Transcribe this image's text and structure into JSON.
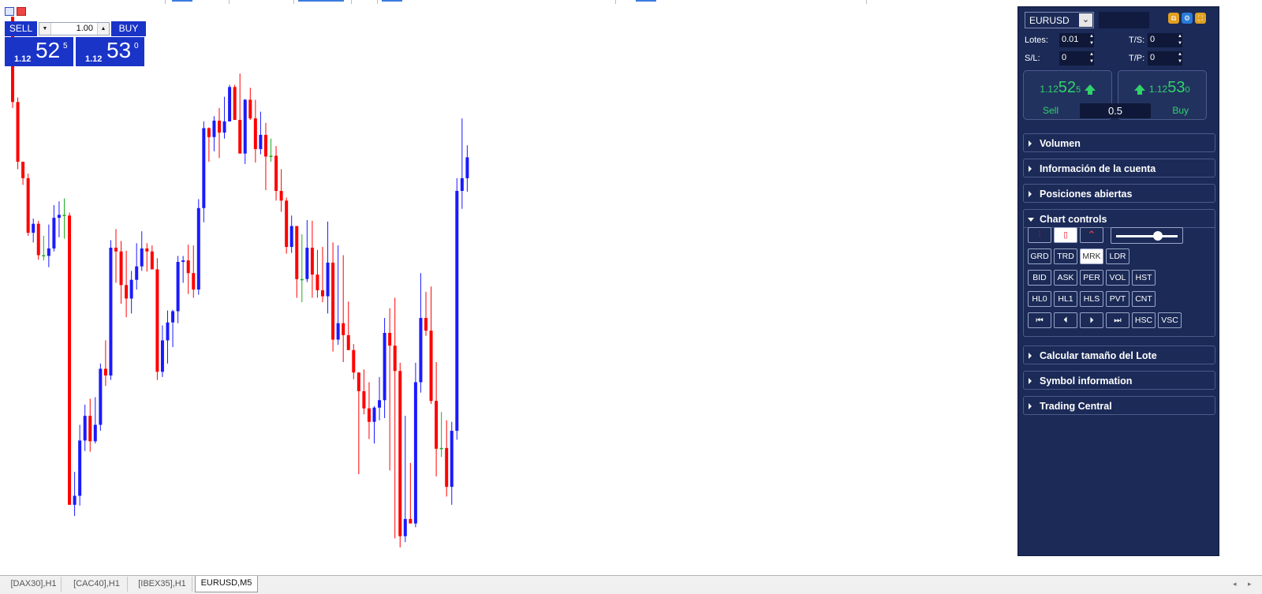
{
  "one_click": {
    "sell_label": "SELL",
    "buy_label": "BUY",
    "lot_value": "1.00",
    "sell_price": {
      "prefix": "1.12",
      "big": "52",
      "sup": "5"
    },
    "buy_price": {
      "prefix": "1.12",
      "big": "53",
      "sup": "0"
    }
  },
  "panel": {
    "symbol": "EURUSD",
    "lotes_label": "Lotes:",
    "lotes_value": "0.01",
    "ts_label": "T/S:",
    "ts_value": "0",
    "sl_label": "S/L:",
    "sl_value": "0",
    "tp_label": "T/P:",
    "tp_value": "0",
    "sell_price": {
      "prefix": "1.12",
      "big": "52",
      "sup": "5"
    },
    "buy_price": {
      "prefix": "1.12",
      "big": "53",
      "sup": "0"
    },
    "sell_label": "Sell",
    "buy_label": "Buy",
    "lot_center": "0.5",
    "sections": {
      "volumen": "Volumen",
      "cuenta": "Información de la cuenta",
      "posiciones": "Posiciones abiertas",
      "chart_controls": "Chart controls",
      "lote": "Calcular tamaño del Lote",
      "symbol_info": "Symbol information",
      "trading_central": "Trading Central"
    },
    "control_rows": [
      [
        "GRD",
        "TRD",
        "MRK",
        "LDR"
      ],
      [
        "BID",
        "ASK",
        "PER",
        "VOL",
        "HST"
      ],
      [
        "HL0",
        "HL1",
        "HLS",
        "PVT",
        "CNT"
      ],
      [
        "⏮",
        "⏴",
        "⏵",
        "⏭",
        "HSC",
        "VSC"
      ]
    ],
    "active_control": "MRK",
    "slider_level": 0.68,
    "colors": {
      "panel": "#1b2a57",
      "price_green": "#2fd36a",
      "btn_blue": "#1a34c8"
    }
  },
  "tabs": [
    "[DAX30],H1",
    "[CAC40],H1",
    "[IBEX35],H1",
    "EURUSD,M5"
  ],
  "active_tab": "EURUSD,M5",
  "chart_data": {
    "type": "candlestick",
    "symbol": "EURUSD",
    "timeframe": "M5",
    "ylim": [
      1.1186,
      1.1262
    ],
    "bull_color": "#1a1aff",
    "bear_color": "#ff0000",
    "doji_color": "#22aa22",
    "candles": [
      {
        "o": 1.12606,
        "h": 1.12606,
        "l": 1.12484,
        "c": 1.12492
      },
      {
        "o": 1.12492,
        "h": 1.12498,
        "l": 1.12402,
        "c": 1.12412
      },
      {
        "o": 1.12412,
        "h": 1.12412,
        "l": 1.12381,
        "c": 1.1239
      },
      {
        "o": 1.1239,
        "h": 1.12396,
        "l": 1.12313,
        "c": 1.12317
      },
      {
        "o": 1.12317,
        "h": 1.12336,
        "l": 1.12304,
        "c": 1.12329
      },
      {
        "o": 1.12329,
        "h": 1.12333,
        "l": 1.12281,
        "c": 1.12287
      },
      {
        "o": 1.12287,
        "h": 1.12313,
        "l": 1.1228,
        "c": 1.12286
      },
      {
        "o": 1.12286,
        "h": 1.12328,
        "l": 1.12271,
        "c": 1.12296
      },
      {
        "o": 1.12296,
        "h": 1.12354,
        "l": 1.12292,
        "c": 1.12337
      },
      {
        "o": 1.12337,
        "h": 1.12359,
        "l": 1.12311,
        "c": 1.12341
      },
      {
        "o": 1.12341,
        "h": 1.12363,
        "l": 1.12309,
        "c": 1.1234
      },
      {
        "o": 1.1234,
        "h": 1.12344,
        "l": 1.1199,
        "c": 1.11953
      },
      {
        "o": 1.11953,
        "h": 1.11997,
        "l": 1.11938,
        "c": 1.11965
      },
      {
        "o": 1.11965,
        "h": 1.1206,
        "l": 1.11952,
        "c": 1.12039
      },
      {
        "o": 1.12039,
        "h": 1.12087,
        "l": 1.12025,
        "c": 1.12072
      },
      {
        "o": 1.12072,
        "h": 1.12095,
        "l": 1.12024,
        "c": 1.12038
      },
      {
        "o": 1.12038,
        "h": 1.12097,
        "l": 1.12035,
        "c": 1.1206
      },
      {
        "o": 1.1206,
        "h": 1.12142,
        "l": 1.12052,
        "c": 1.12135
      },
      {
        "o": 1.12135,
        "h": 1.12173,
        "l": 1.12112,
        "c": 1.12126
      },
      {
        "o": 1.12126,
        "h": 1.12307,
        "l": 1.1212,
        "c": 1.12297
      },
      {
        "o": 1.12297,
        "h": 1.12322,
        "l": 1.1225,
        "c": 1.12292
      },
      {
        "o": 1.12292,
        "h": 1.12306,
        "l": 1.12222,
        "c": 1.12247
      },
      {
        "o": 1.12247,
        "h": 1.12293,
        "l": 1.12204,
        "c": 1.12229
      },
      {
        "o": 1.12229,
        "h": 1.12266,
        "l": 1.12209,
        "c": 1.12254
      },
      {
        "o": 1.12254,
        "h": 1.12303,
        "l": 1.12241,
        "c": 1.12272
      },
      {
        "o": 1.12272,
        "h": 1.12319,
        "l": 1.12266,
        "c": 1.12296
      },
      {
        "o": 1.12296,
        "h": 1.12303,
        "l": 1.12265,
        "c": 1.12292
      },
      {
        "o": 1.12292,
        "h": 1.123,
        "l": 1.12269,
        "c": 1.12268
      },
      {
        "o": 1.12268,
        "h": 1.12283,
        "l": 1.1212,
        "c": 1.12131
      },
      {
        "o": 1.12131,
        "h": 1.12193,
        "l": 1.12124,
        "c": 1.12173
      },
      {
        "o": 1.12173,
        "h": 1.12213,
        "l": 1.12142,
        "c": 1.12197
      },
      {
        "o": 1.12197,
        "h": 1.12214,
        "l": 1.12164,
        "c": 1.12212
      },
      {
        "o": 1.12212,
        "h": 1.12286,
        "l": 1.12196,
        "c": 1.12278
      },
      {
        "o": 1.12278,
        "h": 1.12286,
        "l": 1.1225,
        "c": 1.1228
      },
      {
        "o": 1.1228,
        "h": 1.12301,
        "l": 1.12235,
        "c": 1.12263
      },
      {
        "o": 1.12263,
        "h": 1.123,
        "l": 1.1223,
        "c": 1.12241
      },
      {
        "o": 1.12241,
        "h": 1.12362,
        "l": 1.12234,
        "c": 1.1235
      },
      {
        "o": 1.1235,
        "h": 1.12466,
        "l": 1.12331,
        "c": 1.12457
      },
      {
        "o": 1.12457,
        "h": 1.12458,
        "l": 1.12412,
        "c": 1.12445
      },
      {
        "o": 1.12445,
        "h": 1.12473,
        "l": 1.12426,
        "c": 1.12467
      },
      {
        "o": 1.12467,
        "h": 1.12484,
        "l": 1.12417,
        "c": 1.12451
      },
      {
        "o": 1.12451,
        "h": 1.12499,
        "l": 1.12443,
        "c": 1.12466
      },
      {
        "o": 1.12466,
        "h": 1.12515,
        "l": 1.12466,
        "c": 1.12512
      },
      {
        "o": 1.12512,
        "h": 1.12515,
        "l": 1.12482,
        "c": 1.12468
      },
      {
        "o": 1.12468,
        "h": 1.1253,
        "l": 1.12427,
        "c": 1.12423
      },
      {
        "o": 1.12423,
        "h": 1.12496,
        "l": 1.12409,
        "c": 1.12495
      },
      {
        "o": 1.12495,
        "h": 1.12511,
        "l": 1.12468,
        "c": 1.1247
      },
      {
        "o": 1.1247,
        "h": 1.12495,
        "l": 1.12411,
        "c": 1.12429
      },
      {
        "o": 1.12429,
        "h": 1.12479,
        "l": 1.12422,
        "c": 1.12448
      },
      {
        "o": 1.12448,
        "h": 1.12464,
        "l": 1.12374,
        "c": 1.12419
      },
      {
        "o": 1.12419,
        "h": 1.12443,
        "l": 1.12412,
        "c": 1.1242
      },
      {
        "o": 1.1242,
        "h": 1.12433,
        "l": 1.1236,
        "c": 1.12373
      },
      {
        "o": 1.12373,
        "h": 1.12402,
        "l": 1.12345,
        "c": 1.1236
      },
      {
        "o": 1.1236,
        "h": 1.12364,
        "l": 1.12289,
        "c": 1.12298
      },
      {
        "o": 1.12298,
        "h": 1.1234,
        "l": 1.1229,
        "c": 1.12326
      },
      {
        "o": 1.12326,
        "h": 1.1232,
        "l": 1.1223,
        "c": 1.12255
      },
      {
        "o": 1.12255,
        "h": 1.12315,
        "l": 1.12224,
        "c": 1.12255
      },
      {
        "o": 1.12255,
        "h": 1.12334,
        "l": 1.12251,
        "c": 1.12297
      },
      {
        "o": 1.12297,
        "h": 1.12333,
        "l": 1.1223,
        "c": 1.12261
      },
      {
        "o": 1.12261,
        "h": 1.12294,
        "l": 1.1223,
        "c": 1.1224
      },
      {
        "o": 1.1224,
        "h": 1.12298,
        "l": 1.12224,
        "c": 1.12232
      },
      {
        "o": 1.12232,
        "h": 1.12332,
        "l": 1.12209,
        "c": 1.12277
      },
      {
        "o": 1.12277,
        "h": 1.12304,
        "l": 1.12158,
        "c": 1.12174
      },
      {
        "o": 1.12174,
        "h": 1.123,
        "l": 1.12167,
        "c": 1.12196
      },
      {
        "o": 1.12196,
        "h": 1.12287,
        "l": 1.12144,
        "c": 1.1218
      },
      {
        "o": 1.1218,
        "h": 1.12225,
        "l": 1.12161,
        "c": 1.1216
      },
      {
        "o": 1.1216,
        "h": 1.12168,
        "l": 1.12121,
        "c": 1.1213
      },
      {
        "o": 1.1213,
        "h": 1.12102,
        "l": 1.11994,
        "c": 1.12105
      },
      {
        "o": 1.12105,
        "h": 1.12134,
        "l": 1.12074,
        "c": 1.12082
      },
      {
        "o": 1.12082,
        "h": 1.12117,
        "l": 1.12041,
        "c": 1.12064
      },
      {
        "o": 1.12064,
        "h": 1.12085,
        "l": 1.12035,
        "c": 1.12083
      },
      {
        "o": 1.12083,
        "h": 1.12124,
        "l": 1.12066,
        "c": 1.12093
      },
      {
        "o": 1.12093,
        "h": 1.12203,
        "l": 1.12069,
        "c": 1.12183
      },
      {
        "o": 1.12183,
        "h": 1.12216,
        "l": 1.11999,
        "c": 1.12166
      },
      {
        "o": 1.12166,
        "h": 1.1223,
        "l": 1.11908,
        "c": 1.12132
      },
      {
        "o": 1.12132,
        "h": 1.12143,
        "l": 1.11896,
        "c": 1.11911
      },
      {
        "o": 1.11911,
        "h": 1.12072,
        "l": 1.11903,
        "c": 1.11934
      },
      {
        "o": 1.11934,
        "h": 1.12009,
        "l": 1.1199,
        "c": 1.11928
      },
      {
        "o": 1.11928,
        "h": 1.12143,
        "l": 1.11923,
        "c": 1.12117
      },
      {
        "o": 1.12117,
        "h": 1.12263,
        "l": 1.12103,
        "c": 1.12203
      },
      {
        "o": 1.12203,
        "h": 1.12238,
        "l": 1.12179,
        "c": 1.12186
      },
      {
        "o": 1.12186,
        "h": 1.12245,
        "l": 1.12088,
        "c": 1.12092
      },
      {
        "o": 1.12092,
        "h": 1.12144,
        "l": 1.11991,
        "c": 1.12028
      },
      {
        "o": 1.12028,
        "h": 1.12077,
        "l": 1.12017,
        "c": 1.12029
      },
      {
        "o": 1.12029,
        "h": 1.12066,
        "l": 1.11964,
        "c": 1.11977
      },
      {
        "o": 1.11977,
        "h": 1.12064,
        "l": 1.11953,
        "c": 1.12052
      },
      {
        "o": 1.12052,
        "h": 1.1239,
        "l": 1.1204,
        "c": 1.12373
      },
      {
        "o": 1.12373,
        "h": 1.1247,
        "l": 1.12349,
        "c": 1.1239
      },
      {
        "o": 1.1239,
        "h": 1.12434,
        "l": 1.12372,
        "c": 1.12418
      }
    ]
  }
}
